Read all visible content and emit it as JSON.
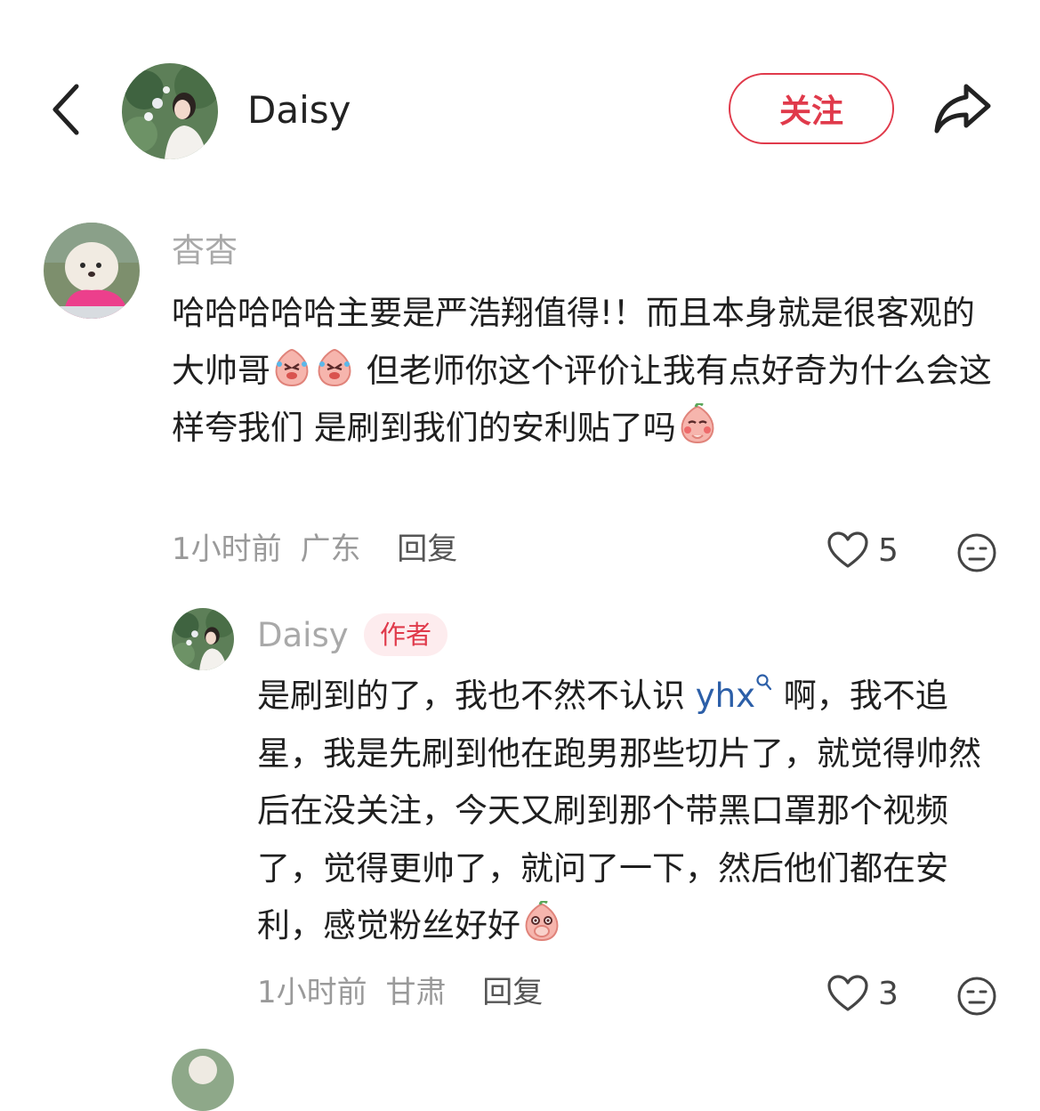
{
  "header": {
    "name": "Daisy",
    "follow_label": "关注"
  },
  "comment": {
    "username": "杳杳",
    "text_part1": "哈哈哈哈哈主要是严浩翔值得!！而且本身就是很客观的大帅哥",
    "text_part2": " 但老师你这个评价让我有点好奇为什么会这样夸我们 是刷到我们的安利贴了吗",
    "time": "1小时前",
    "location": "广东",
    "reply_label": "回复",
    "likes": "5"
  },
  "reply": {
    "username": "Daisy",
    "author_tag": "作者",
    "text_part1": "是刷到的了，我也不然不认识 ",
    "mention": "yhx",
    "text_part2": " 啊，我不追星，我是先刷到他在跑男那些切片了，就觉得帅然后在没关注，今天又刷到那个带黑口罩那个视频了，觉得更帅了，就问了一下，然后他们都在安利，感觉粉丝好好",
    "time": "1小时前",
    "location": "甘肃",
    "reply_label": "回复",
    "likes": "3"
  },
  "colors": {
    "accent": "#e03a4b",
    "mention": "#2c5fa8",
    "muted": "#a9a9a9"
  }
}
